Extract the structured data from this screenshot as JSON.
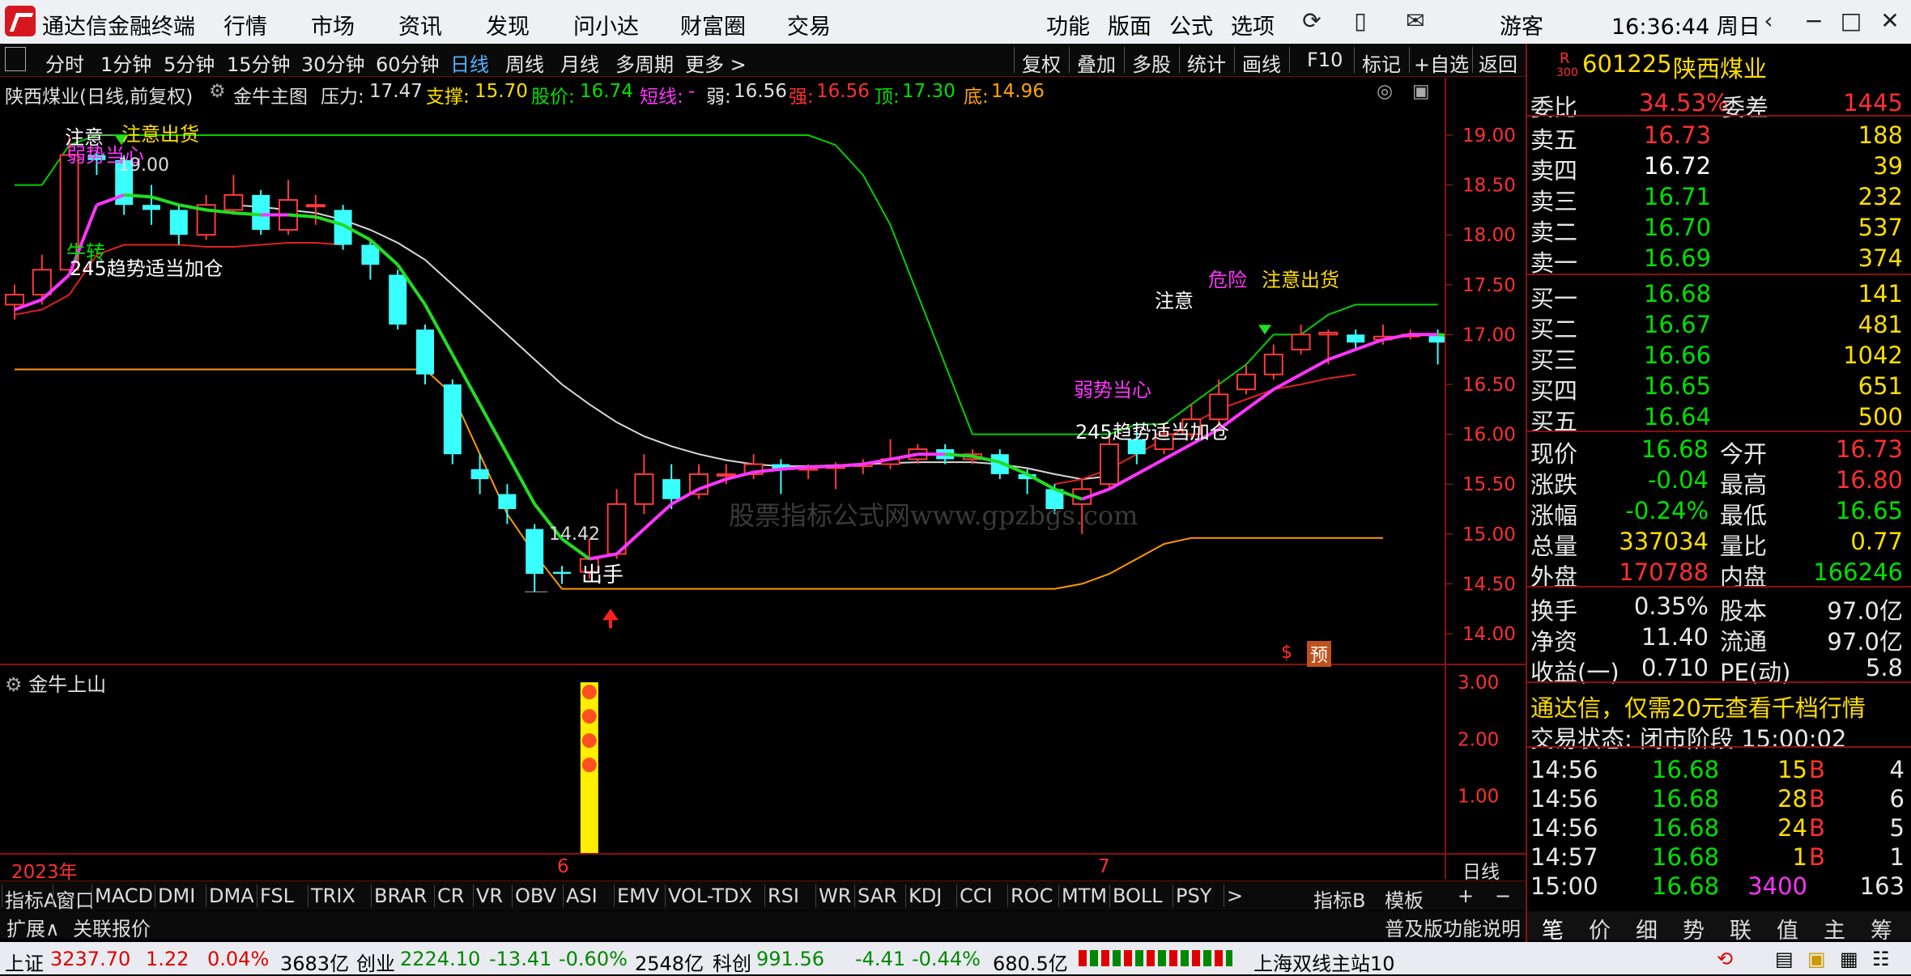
{
  "window": {
    "app_title": "通达信金融终端",
    "menu": [
      "行情",
      "市场",
      "资讯",
      "发现",
      "问小达",
      "财富圈",
      "交易"
    ],
    "right_menu": [
      "功能",
      "版面",
      "公式",
      "选项"
    ],
    "user": "游客",
    "clock": "16:36:44 周日"
  },
  "periods": [
    "分时",
    "1分钟",
    "5分钟",
    "15分钟",
    "30分钟",
    "60分钟",
    "日线",
    "周线",
    "月线",
    "多周期",
    "更多 >"
  ],
  "active_period": "日线",
  "tools": [
    "复权",
    "叠加",
    "多股",
    "统计",
    "画线",
    "F10",
    "标记",
    "+自选",
    "返回"
  ],
  "info": {
    "title": "陕西煤业(日线,前复权)",
    "formula": "金牛主图",
    "pressure_label": "压力:",
    "pressure": "17.47",
    "support_label": "支撑:",
    "support": "15.70",
    "price_label": "股价:",
    "price": "16.74",
    "short_label": "短线:",
    "short": "-",
    "weak_label": "弱:",
    "weak": "16.56",
    "strong_label": "强:",
    "strong": "16.56",
    "top_label": "顶:",
    "top": "17.30",
    "bottom_label": "底:",
    "bottom": "14.96"
  },
  "price_axis": [
    "19.00",
    "18.50",
    "18.00",
    "17.50",
    "17.00",
    "16.50",
    "16.00",
    "15.50",
    "15.00",
    "14.50",
    "14.00"
  ],
  "annotations": {
    "a1": "注意",
    "a2": "注意出货",
    "a3": "弱势当心",
    "a4": "19.00",
    "a5": "牛转",
    "a6": "245趋势适当加仓",
    "a7": "14.42",
    "a8": "出手",
    "a9": "注意",
    "a10": "危险",
    "a11": "注意出货",
    "a12": "弱势当心",
    "a13": "245趋势适当加仓",
    "watermark": "股票指标公式网www.gpzbgs.com",
    "s": "$",
    "yu": "预"
  },
  "sub": {
    "name": "金牛上山",
    "axis": [
      "3.00",
      "2.00",
      "1.00"
    ]
  },
  "dates": {
    "year": "2023年",
    "m6": "6",
    "m7": "7",
    "line": "日线"
  },
  "indicators": [
    "指标A",
    "窗口",
    "MACD",
    "DMI",
    "DMA",
    "FSL",
    "TRIX",
    "BRAR",
    "CR",
    "VR",
    "OBV",
    "ASI",
    "EMV",
    "VOL-TDX",
    "RSI",
    "WR",
    "SAR",
    "KDJ",
    "CCI",
    "ROC",
    "MTM",
    "BOLL",
    "PSY",
    ">"
  ],
  "indicator_b": "指标B",
  "template": "模板",
  "ext": [
    "扩展∧",
    "关联报价"
  ],
  "help": "普及版功能说明",
  "quote": {
    "badge": "R",
    "badge_sub": "300",
    "code": "601225",
    "name": "陕西煤业",
    "wb_label": "委比",
    "wb": "34.53%",
    "wc_label": "委差",
    "wc": "1445",
    "asks": [
      {
        "label": "卖五",
        "price": "16.73",
        "vol": "188"
      },
      {
        "label": "卖四",
        "price": "16.72",
        "vol": "39"
      },
      {
        "label": "卖三",
        "price": "16.71",
        "vol": "232"
      },
      {
        "label": "卖二",
        "price": "16.70",
        "vol": "537"
      },
      {
        "label": "卖一",
        "price": "16.69",
        "vol": "374"
      }
    ],
    "bids": [
      {
        "label": "买一",
        "price": "16.68",
        "vol": "141"
      },
      {
        "label": "买二",
        "price": "16.67",
        "vol": "481"
      },
      {
        "label": "买三",
        "price": "16.66",
        "vol": "1042"
      },
      {
        "label": "买四",
        "price": "16.65",
        "vol": "651"
      },
      {
        "label": "买五",
        "price": "16.64",
        "vol": "500"
      }
    ],
    "stats": [
      {
        "l1": "现价",
        "v1": "16.68",
        "l2": "今开",
        "v2": "16.73"
      },
      {
        "l1": "涨跌",
        "v1": "-0.04",
        "l2": "最高",
        "v2": "16.80"
      },
      {
        "l1": "涨幅",
        "v1": "-0.24%",
        "l2": "最低",
        "v2": "16.65"
      },
      {
        "l1": "总量",
        "v1": "337034",
        "l2": "量比",
        "v2": "0.77"
      },
      {
        "l1": "外盘",
        "v1": "170788",
        "l2": "内盘",
        "v2": "166246"
      }
    ],
    "stats2": [
      {
        "l1": "换手",
        "v1": "0.35%",
        "l2": "股本",
        "v2": "97.0亿"
      },
      {
        "l1": "净资",
        "v1": "11.40",
        "l2": "流通",
        "v2": "97.0亿"
      },
      {
        "l1": "收益(一)",
        "v1": "0.710",
        "l2": "PE(动)",
        "v2": "5.8"
      }
    ],
    "ad": "通达信，仅需20元查看千档行情",
    "trade_state": "交易状态: 闭市阶段 15:00:02",
    "ticks": [
      {
        "t": "14:56",
        "p": "16.68",
        "v": "15",
        "s": "B",
        "n": "4"
      },
      {
        "t": "14:56",
        "p": "16.68",
        "v": "28",
        "s": "B",
        "n": "6"
      },
      {
        "t": "14:56",
        "p": "16.68",
        "v": "24",
        "s": "B",
        "n": "5"
      },
      {
        "t": "14:57",
        "p": "16.68",
        "v": "1",
        "s": "B",
        "n": "1"
      },
      {
        "t": "15:00",
        "p": "16.68",
        "v": "3400",
        "s": "",
        "n": "163"
      }
    ],
    "tabs": [
      "笔",
      "价",
      "细",
      "势",
      "联",
      "值",
      "主",
      "筹"
    ]
  },
  "status": {
    "sh_label": "上证",
    "sh": "3237.70",
    "sh_chg": "1.22",
    "sh_pct": "0.04%",
    "sh_amt": "3683亿",
    "cy_label": "创业",
    "cy": "2224.10",
    "cy_chg": "-13.41",
    "cy_pct": "-0.60%",
    "cy_amt": "2548亿",
    "kc_label": "科创",
    "kc": "991.56",
    "kc_chg": "-4.41",
    "kc_pct": "-0.44%",
    "kc_amt": "680.5亿",
    "server": "上海双线主站10"
  },
  "chart_data": {
    "type": "candlestick",
    "ylim": [
      13.7,
      19.3
    ],
    "candles": [
      {
        "o": 17.3,
        "c": 17.4,
        "h": 17.5,
        "l": 17.15
      },
      {
        "o": 17.4,
        "c": 17.65,
        "h": 17.8,
        "l": 17.3
      },
      {
        "o": 17.65,
        "c": 18.8,
        "h": 19.0,
        "l": 17.6
      },
      {
        "o": 18.8,
        "c": 18.75,
        "h": 18.85,
        "l": 18.6
      },
      {
        "o": 18.75,
        "c": 18.3,
        "h": 18.8,
        "l": 18.2
      },
      {
        "o": 18.3,
        "c": 18.25,
        "h": 18.5,
        "l": 18.1
      },
      {
        "o": 18.25,
        "c": 18.0,
        "h": 18.3,
        "l": 17.9
      },
      {
        "o": 18.0,
        "c": 18.3,
        "h": 18.4,
        "l": 17.95
      },
      {
        "o": 18.25,
        "c": 18.4,
        "h": 18.6,
        "l": 18.2
      },
      {
        "o": 18.4,
        "c": 18.05,
        "h": 18.45,
        "l": 18.0
      },
      {
        "o": 18.05,
        "c": 18.35,
        "h": 18.55,
        "l": 18.0
      },
      {
        "o": 18.3,
        "c": 18.3,
        "h": 18.4,
        "l": 18.1
      },
      {
        "o": 18.25,
        "c": 17.9,
        "h": 18.3,
        "l": 17.85
      },
      {
        "o": 17.9,
        "c": 17.7,
        "h": 17.95,
        "l": 17.55
      },
      {
        "o": 17.6,
        "c": 17.1,
        "h": 17.65,
        "l": 17.05
      },
      {
        "o": 17.05,
        "c": 16.6,
        "h": 17.1,
        "l": 16.5
      },
      {
        "o": 16.5,
        "c": 15.8,
        "h": 16.55,
        "l": 15.7
      },
      {
        "o": 15.65,
        "c": 15.55,
        "h": 15.8,
        "l": 15.4
      },
      {
        "o": 15.4,
        "c": 15.25,
        "h": 15.5,
        "l": 15.1
      },
      {
        "o": 15.05,
        "c": 14.6,
        "h": 15.1,
        "l": 14.42
      },
      {
        "o": 14.62,
        "c": 14.6,
        "h": 14.68,
        "l": 14.5
      },
      {
        "o": 14.62,
        "c": 14.75,
        "h": 14.95,
        "l": 14.55
      },
      {
        "o": 14.8,
        "c": 15.3,
        "h": 15.45,
        "l": 14.75
      },
      {
        "o": 15.3,
        "c": 15.6,
        "h": 15.8,
        "l": 15.2
      },
      {
        "o": 15.55,
        "c": 15.35,
        "h": 15.7,
        "l": 15.25
      },
      {
        "o": 15.4,
        "c": 15.6,
        "h": 15.7,
        "l": 15.35
      },
      {
        "o": 15.6,
        "c": 15.6,
        "h": 15.7,
        "l": 15.5
      },
      {
        "o": 15.6,
        "c": 15.7,
        "h": 15.8,
        "l": 15.55
      },
      {
        "o": 15.7,
        "c": 15.65,
        "h": 15.75,
        "l": 15.4
      },
      {
        "o": 15.65,
        "c": 15.66,
        "h": 15.7,
        "l": 15.55
      },
      {
        "o": 15.66,
        "c": 15.68,
        "h": 15.72,
        "l": 15.45
      },
      {
        "o": 15.68,
        "c": 15.7,
        "h": 15.75,
        "l": 15.6
      },
      {
        "o": 15.7,
        "c": 15.75,
        "h": 15.95,
        "l": 15.65
      },
      {
        "o": 15.75,
        "c": 15.85,
        "h": 15.9,
        "l": 15.7
      },
      {
        "o": 15.85,
        "c": 15.75,
        "h": 15.9,
        "l": 15.7
      },
      {
        "o": 15.75,
        "c": 15.8,
        "h": 15.85,
        "l": 15.7
      },
      {
        "o": 15.8,
        "c": 15.6,
        "h": 15.85,
        "l": 15.55
      },
      {
        "o": 15.6,
        "c": 15.55,
        "h": 15.65,
        "l": 15.4
      },
      {
        "o": 15.45,
        "c": 15.25,
        "h": 15.5,
        "l": 15.2
      },
      {
        "o": 15.3,
        "c": 15.45,
        "h": 15.55,
        "l": 15.0
      },
      {
        "o": 15.5,
        "c": 15.9,
        "h": 16.0,
        "l": 15.45
      },
      {
        "o": 15.95,
        "c": 15.8,
        "h": 16.05,
        "l": 15.7
      },
      {
        "o": 15.85,
        "c": 16.0,
        "h": 16.1,
        "l": 15.8
      },
      {
        "o": 16.0,
        "c": 16.15,
        "h": 16.3,
        "l": 15.95
      },
      {
        "o": 16.15,
        "c": 16.4,
        "h": 16.55,
        "l": 16.05
      },
      {
        "o": 16.45,
        "c": 16.6,
        "h": 16.7,
        "l": 16.4
      },
      {
        "o": 16.6,
        "c": 16.8,
        "h": 16.9,
        "l": 16.55
      },
      {
        "o": 16.85,
        "c": 17.0,
        "h": 17.1,
        "l": 16.8
      },
      {
        "o": 17.0,
        "c": 17.02,
        "h": 17.05,
        "l": 16.7
      },
      {
        "o": 17.0,
        "c": 16.92,
        "h": 17.05,
        "l": 16.85
      },
      {
        "o": 16.95,
        "c": 16.98,
        "h": 17.1,
        "l": 16.9
      },
      {
        "o": 16.98,
        "c": 17.0,
        "h": 17.05,
        "l": 16.95
      },
      {
        "o": 17.0,
        "c": 16.92,
        "h": 17.05,
        "l": 16.7
      },
      {
        "o": 16.92,
        "c": 16.95,
        "h": 17.0,
        "l": 16.75
      },
      {
        "o": 16.95,
        "c": 16.85,
        "h": 17.0,
        "l": 16.8
      },
      {
        "o": 16.75,
        "c": 16.7,
        "h": 16.8,
        "l": 16.6
      },
      {
        "o": 16.73,
        "c": 16.68,
        "h": 16.8,
        "l": 16.65
      }
    ],
    "short_line": [
      17.25,
      17.35,
      17.6,
      18.3,
      18.4,
      18.38,
      18.3,
      18.25,
      18.22,
      18.2,
      18.2,
      18.18,
      18.1,
      17.95,
      17.7,
      17.3,
      16.8,
      16.3,
      15.8,
      15.3,
      14.95,
      14.75,
      14.8,
      15.05,
      15.3,
      15.45,
      15.55,
      15.62,
      15.65,
      15.67,
      15.68,
      15.7,
      15.75,
      15.8,
      15.8,
      15.78,
      15.72,
      15.6,
      15.45,
      15.35,
      15.45,
      15.6,
      15.75,
      15.9,
      16.05,
      16.25,
      16.45,
      16.6,
      16.75,
      16.85,
      16.95,
      17.0,
      17.0,
      16.98,
      16.95,
      16.9,
      16.82
    ],
    "white_line": [
      null,
      null,
      null,
      null,
      null,
      null,
      null,
      null,
      18.3,
      18.28,
      18.25,
      18.22,
      18.15,
      18.05,
      17.92,
      17.75,
      17.5,
      17.25,
      17.0,
      16.75,
      16.5,
      16.3,
      16.12,
      15.98,
      15.88,
      15.8,
      15.74,
      15.7,
      15.68,
      15.68,
      15.69,
      15.7,
      15.71,
      15.72,
      15.72,
      15.72,
      15.7,
      15.66,
      15.6,
      15.55,
      15.58
    ],
    "upper_band": [
      18.5,
      18.5,
      18.9,
      19.0,
      19.0,
      19.0,
      19.0,
      19.0,
      19.0,
      19.0,
      19.0,
      19.0,
      19.0,
      19.0,
      19.0,
      19.0,
      19.0,
      19.0,
      19.0,
      19.0,
      19.0,
      19.0,
      19.0,
      19.0,
      19.0,
      19.0,
      19.0,
      19.0,
      19.0,
      19.0,
      18.9,
      18.6,
      18.1,
      17.4,
      16.7,
      16.0,
      16.0,
      16.0,
      16.0,
      16.0,
      16.0,
      16.1,
      16.1,
      16.3,
      16.5,
      16.7,
      17.0,
      17.0,
      17.2,
      17.3,
      17.3,
      17.3,
      17.3
    ],
    "lower_band": [
      16.65,
      16.65,
      16.65,
      16.65,
      16.65,
      16.65,
      16.65,
      16.65,
      16.65,
      16.65,
      16.65,
      16.65,
      16.65,
      16.65,
      16.65,
      16.65,
      16.4,
      15.8,
      15.2,
      14.8,
      14.45,
      14.45,
      14.45,
      14.45,
      14.45,
      14.45,
      14.45,
      14.45,
      14.45,
      14.45,
      14.45,
      14.45,
      14.45,
      14.45,
      14.45,
      14.45,
      14.45,
      14.45,
      14.45,
      14.5,
      14.6,
      14.75,
      14.9,
      14.96,
      14.96,
      14.96,
      14.96,
      14.96,
      14.96,
      14.96,
      14.96
    ],
    "red_support": [
      17.2,
      17.25,
      17.4,
      17.8,
      17.9,
      17.9,
      17.9,
      17.88,
      17.88,
      17.9,
      17.92,
      17.92,
      17.9,
      null,
      null,
      null,
      null,
      null,
      null,
      null,
      null,
      null,
      null,
      null,
      null,
      null,
      null,
      null,
      null,
      null,
      null,
      null,
      null,
      null,
      null,
      null,
      null,
      null,
      15.5,
      15.55,
      15.65,
      15.8,
      15.95,
      16.1,
      16.25,
      16.35,
      16.45,
      16.5,
      16.56,
      16.6
    ],
    "sub_bar": {
      "index": 21,
      "value": 3.0,
      "ylim": [
        0,
        3.3
      ]
    }
  }
}
